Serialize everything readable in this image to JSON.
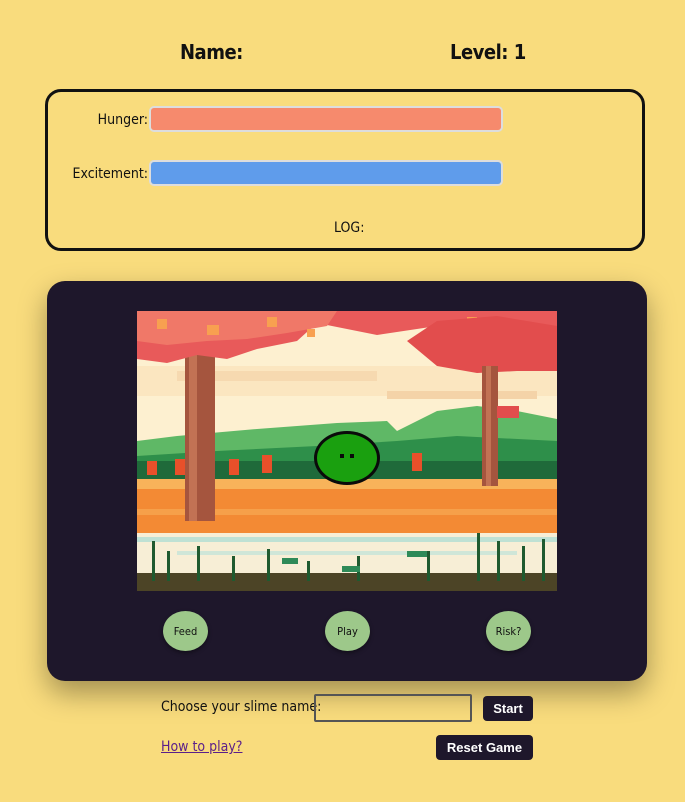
{
  "header": {
    "name_label": "Name:",
    "level_label": "Level: 1"
  },
  "stats": {
    "hunger_label": "Hunger:",
    "hunger_level": 1.0,
    "hunger_color": "#f68a6d",
    "excitement_label": "Excitement:",
    "excitement_level": 1.0,
    "excitement_color": "#5f9ceb",
    "log_label": "LOG:"
  },
  "actions": {
    "feed": "Feed",
    "play": "Play",
    "risk": "Risk?"
  },
  "controls": {
    "name_prompt": "Choose your slime name:",
    "name_value": "",
    "start_label": "Start",
    "how_to_play": "How to play?",
    "reset_label": "Reset Game"
  },
  "colors": {
    "background": "#f9dc7d",
    "panel": "#1e172b",
    "button_green": "#9dc88a",
    "slime": "#1aa00f"
  }
}
